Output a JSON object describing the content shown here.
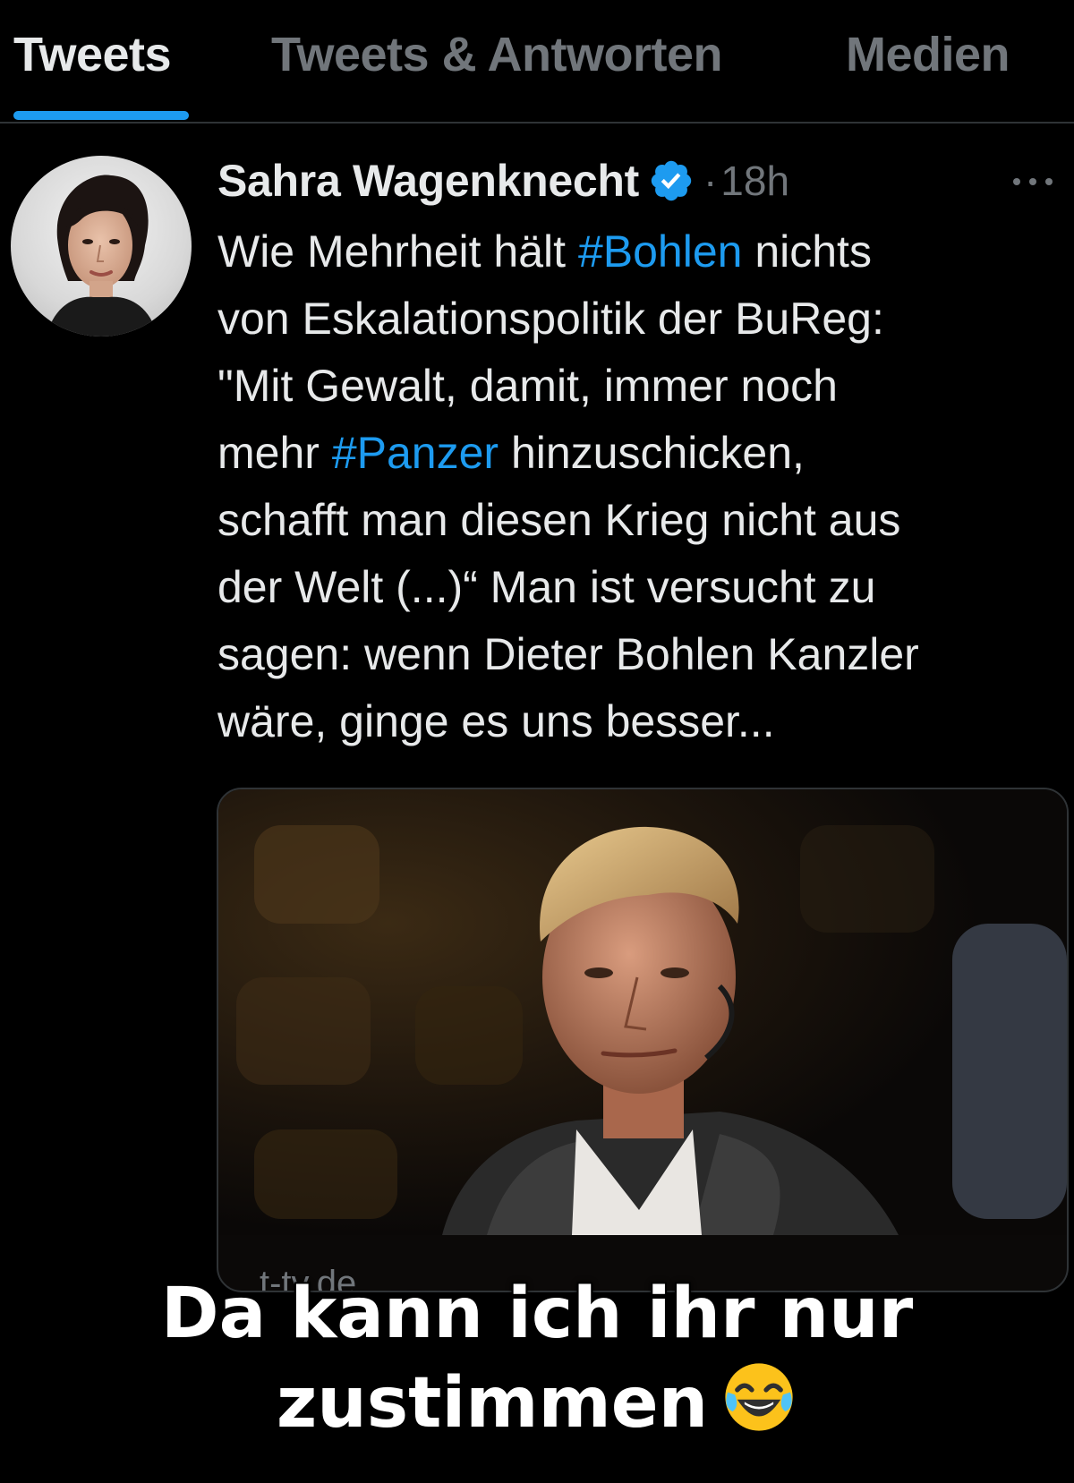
{
  "tabs": [
    {
      "label": "Tweets",
      "active": true
    },
    {
      "label": "Tweets & Antworten",
      "active": false
    },
    {
      "label": "Medien",
      "active": false
    }
  ],
  "tweet": {
    "author_name": "Sahra Wagenknecht",
    "verified_icon": "verified-badge-icon",
    "separator": "·",
    "timestamp": "18h",
    "more_icon": "more-horizontal-icon",
    "text_lines": [
      [
        {
          "t": "Wie Mehrheit hält "
        },
        {
          "t": "#Bohlen",
          "tag": true
        },
        {
          "t": " nichts"
        }
      ],
      [
        {
          "t": "von Eskalationspolitik der BuReg:"
        }
      ],
      [
        {
          "t": "\"Mit Gewalt, damit, immer noch"
        }
      ],
      [
        {
          "t": "mehr "
        },
        {
          "t": "#Panzer",
          "tag": true
        },
        {
          "t": " hinzuschicken,"
        }
      ],
      [
        {
          "t": "schafft man diesen Krieg nicht aus"
        }
      ],
      [
        {
          "t": "der Welt (...)“ Man ist versucht zu"
        }
      ],
      [
        {
          "t": "sagen: wenn Dieter Bohlen Kanzler"
        }
      ],
      [
        {
          "t": "wäre, ginge es uns besser..."
        }
      ]
    ],
    "card_domain": "t-tv.de"
  },
  "caption": {
    "line1": "Da kann ich ihr nur",
    "line2": "zustimmen",
    "emoji": "face-with-tears-of-joy-emoji"
  },
  "colors": {
    "background": "#000000",
    "text_primary": "#e7e9ea",
    "text_secondary": "#71767b",
    "accent": "#1d9bf0",
    "divider": "#2f3336"
  }
}
